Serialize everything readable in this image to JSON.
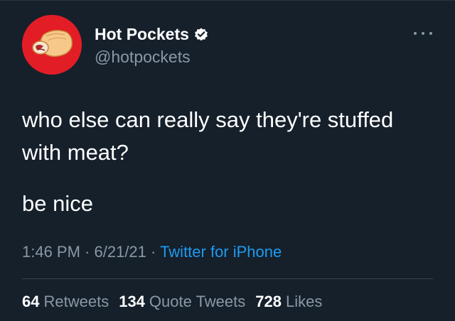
{
  "tweet": {
    "display_name": "Hot Pockets",
    "handle": "@hotpockets",
    "verified": true,
    "avatar_icon": "hot-pocket-logo",
    "more_icon": "more-options-icon",
    "text_line1": "who else can really say they're stuffed",
    "text_line2": "with meat?",
    "text_para2": "be nice",
    "time": "1:46 PM",
    "separator": " · ",
    "date": "6/21/21",
    "source": "Twitter for iPhone",
    "stats": {
      "retweets_count": "64",
      "retweets_label": "Retweets",
      "quotes_count": "134",
      "quotes_label": "Quote Tweets",
      "likes_count": "728",
      "likes_label": "Likes"
    }
  },
  "colors": {
    "background": "#15202b",
    "text_primary": "#ffffff",
    "text_secondary": "#8b98a5",
    "link": "#1d9bf0",
    "verified_badge": "#ffffff",
    "avatar_bg": "#e21d26"
  }
}
